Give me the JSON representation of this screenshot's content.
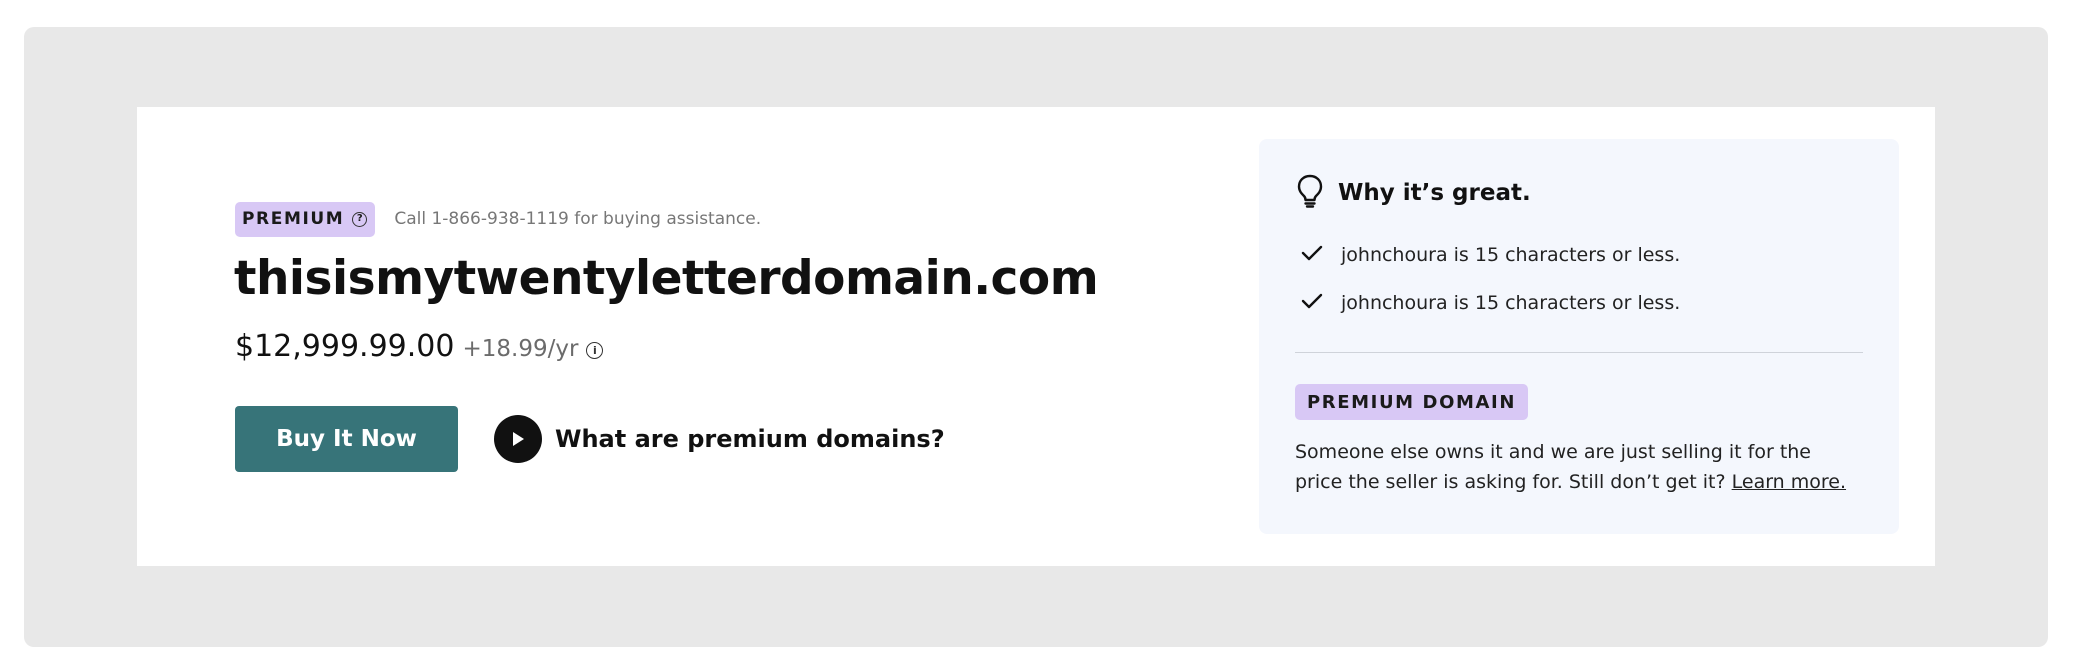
{
  "listing": {
    "badge_label": "PREMIUM",
    "assist_text": "Call 1-866-938-1119 for buying assistance.",
    "domain": "thisismytwentyletterdomain.com",
    "price": "$12,999.99.00",
    "renewal": "+18.99/yr",
    "buy_label": "Buy It Now",
    "video_label": "What are premium domains?"
  },
  "panel": {
    "title": "Why it’s great.",
    "reasons": [
      "johnchoura is 15 characters or less.",
      "johnchoura is 15 characters or less."
    ],
    "tag": "PREMIUM DOMAIN",
    "description": "Someone else owns it and we are just selling it for the price the seller is asking for. Still don’t get it?",
    "learn_more": "Learn more."
  },
  "icons": {
    "badge": "question-circle-icon",
    "price_info": "info-icon",
    "video": "play-icon",
    "why": "lightbulb-icon",
    "reason": "checkmark-icon"
  },
  "colors": {
    "badge_bg": "#d8c8f5",
    "buy_button": "#377479",
    "panel_bg": "#f4f7fd",
    "outer_bg": "#e8e8e8"
  }
}
